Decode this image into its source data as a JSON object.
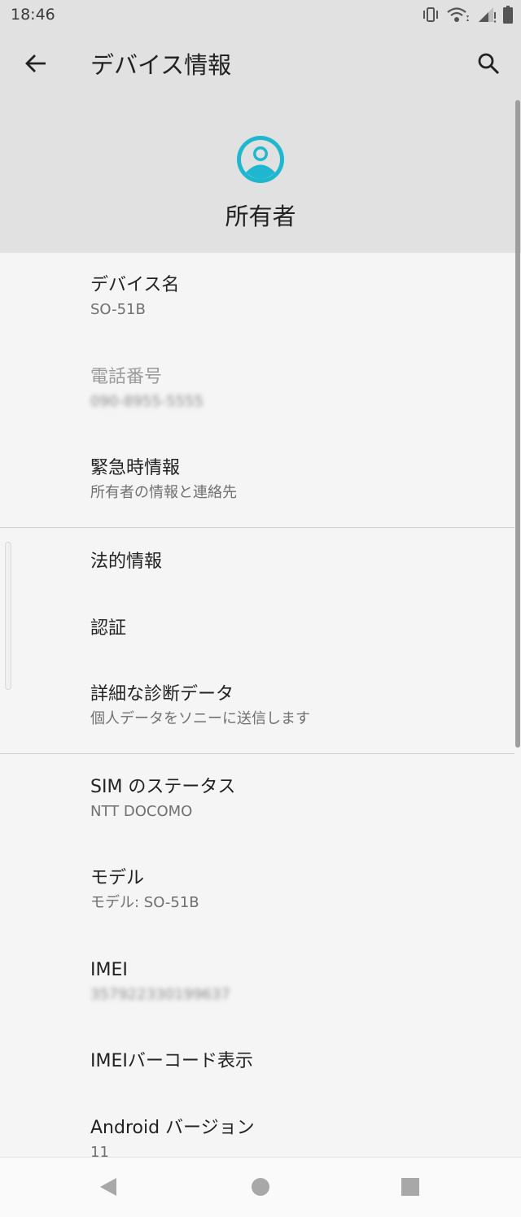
{
  "status_bar": {
    "time": "18:46",
    "icons": [
      "vibrate-icon",
      "wifi-icon",
      "signal-icon",
      "battery-icon"
    ]
  },
  "toolbar": {
    "title": "デバイス情報",
    "back_icon": "arrow-back-icon",
    "search_icon": "search-icon"
  },
  "owner": {
    "avatar_icon": "account-circle-icon",
    "name": "所有者",
    "accent_color": "#1fb6cf"
  },
  "items": [
    {
      "title": "デバイス名",
      "summary": "SO-51B"
    },
    {
      "title": "電話番号",
      "summary": "090-8955-5555",
      "disabled": true,
      "blurred": true
    },
    {
      "title": "緊急時情報",
      "summary": "所有者の情報と連絡先"
    },
    {
      "title": "法的情報"
    },
    {
      "title": "認証"
    },
    {
      "title": "詳細な診断データ",
      "summary": "個人データをソニーに送信します"
    },
    {
      "title": "SIM のステータス",
      "summary": "NTT DOCOMO"
    },
    {
      "title": "モデル",
      "summary": "モデル: SO-51B"
    },
    {
      "title": "IMEI",
      "summary": "357922330199637",
      "blurred": true
    },
    {
      "title": "IMEIバーコード表示"
    },
    {
      "title": "Android バージョン",
      "summary": "11"
    }
  ],
  "nav_bar": {
    "icons": [
      "back-triangle-icon",
      "home-circle-icon",
      "recents-square-icon"
    ]
  }
}
